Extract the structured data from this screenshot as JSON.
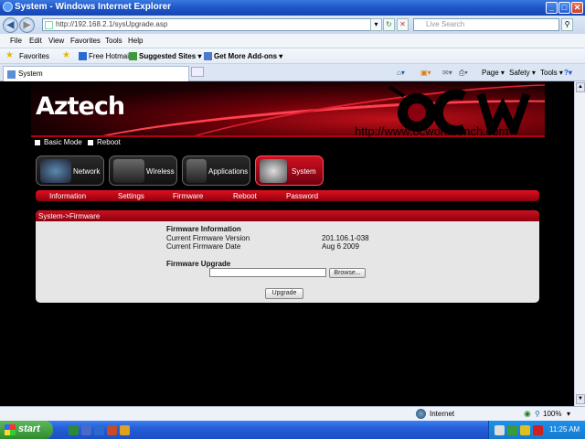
{
  "window": {
    "title": "System - Windows Internet Explorer"
  },
  "address": {
    "url": "http://192.168.2.1/sysUpgrade.asp",
    "search_placeholder": "Live Search"
  },
  "menu": [
    "File",
    "Edit",
    "View",
    "Favorites",
    "Tools",
    "Help"
  ],
  "favorites": {
    "label": "Favorites",
    "items": [
      "Free Hotmail",
      "Suggested Sites ▾",
      "Get More Add-ons ▾"
    ]
  },
  "tab": {
    "title": "System"
  },
  "commands": [
    "Page ▾",
    "Safety ▾",
    "Tools ▾"
  ],
  "banner": {
    "logo": "Aztech",
    "watermark_url": "http://www.ocworkbench.com",
    "watermark_logo": "OCW"
  },
  "modebar": {
    "basic": "Basic Mode",
    "reboot": "Reboot"
  },
  "nav": [
    "Network",
    "Wireless",
    "Applications",
    "System"
  ],
  "subnav": [
    "Information",
    "Settings",
    "Firmware",
    "Reboot",
    "Password"
  ],
  "panel": {
    "heading": "System->Firmware",
    "info_title": "Firmware Information",
    "version_label": "Current Firmware Version",
    "version_value": "201.106.1-038",
    "date_label": "Current Firmware Date",
    "date_value": "Aug 6 2009",
    "upgrade_title": "Firmware Upgrade",
    "browse": "Browse...",
    "upgrade_button": "Upgrade"
  },
  "status": {
    "zone": "Internet",
    "zoom": "100%"
  },
  "taskbar": {
    "start": "start",
    "time": "11:25 AM"
  }
}
